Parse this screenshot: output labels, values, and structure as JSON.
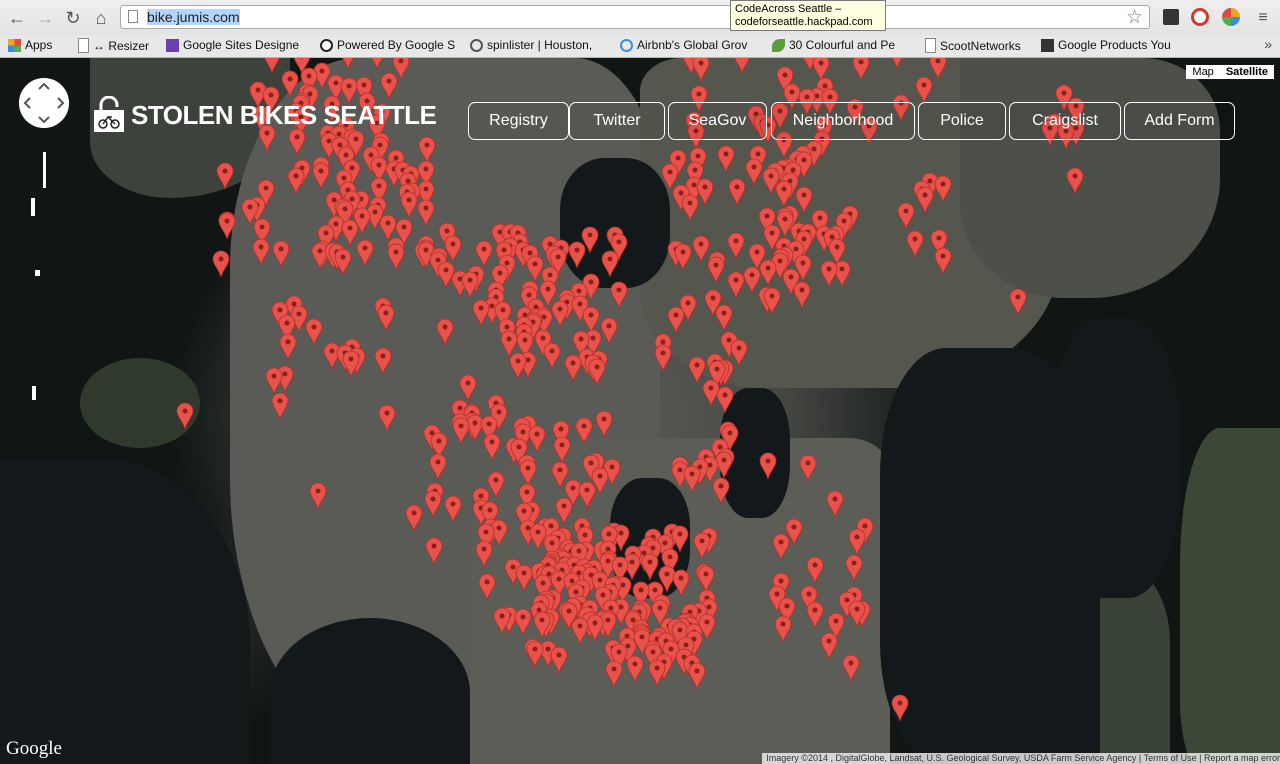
{
  "browser": {
    "url_text": "bike.jumis.com",
    "tooltip_line1": "CodeAcross Seattle –",
    "tooltip_line2": "codeforseattle.hackpad.com",
    "bookmarks": [
      {
        "label": "Apps",
        "icon": "apps-grid-icon"
      },
      {
        "label": "↔ Resizer",
        "icon": "page-icon"
      },
      {
        "label": "Google Sites Designe",
        "icon": "k-logo-icon"
      },
      {
        "label": "Powered By Google S",
        "icon": "g-logo-icon"
      },
      {
        "label": "spinlister | Houston,",
        "icon": "wordpress-icon"
      },
      {
        "label": "Airbnb's Global Grov",
        "icon": "airbnb-icon"
      },
      {
        "label": "30 Colourful and Pe",
        "icon": "leaf-icon"
      },
      {
        "label": "ScootNetworks",
        "icon": "page-icon"
      },
      {
        "label": "Google Products You",
        "icon": "t-logo-icon"
      }
    ],
    "more": "»"
  },
  "site": {
    "title": "STOLEN BIKES SEATTLE",
    "nav": [
      "Registry",
      "Twitter",
      "SeaGov",
      "Neighborhood",
      "Police",
      "Craigslist",
      "Add Form"
    ]
  },
  "map": {
    "type_map": "Map",
    "type_satellite": "Satellite",
    "google": "Google",
    "attribution": "Imagery ©2014 , DigitalGlobe, Landsat, U.S. Geological Survey, USDA Farm Service Agency  |  Terms of Use  |  Report a map error",
    "pin_color": "#e8524a"
  }
}
